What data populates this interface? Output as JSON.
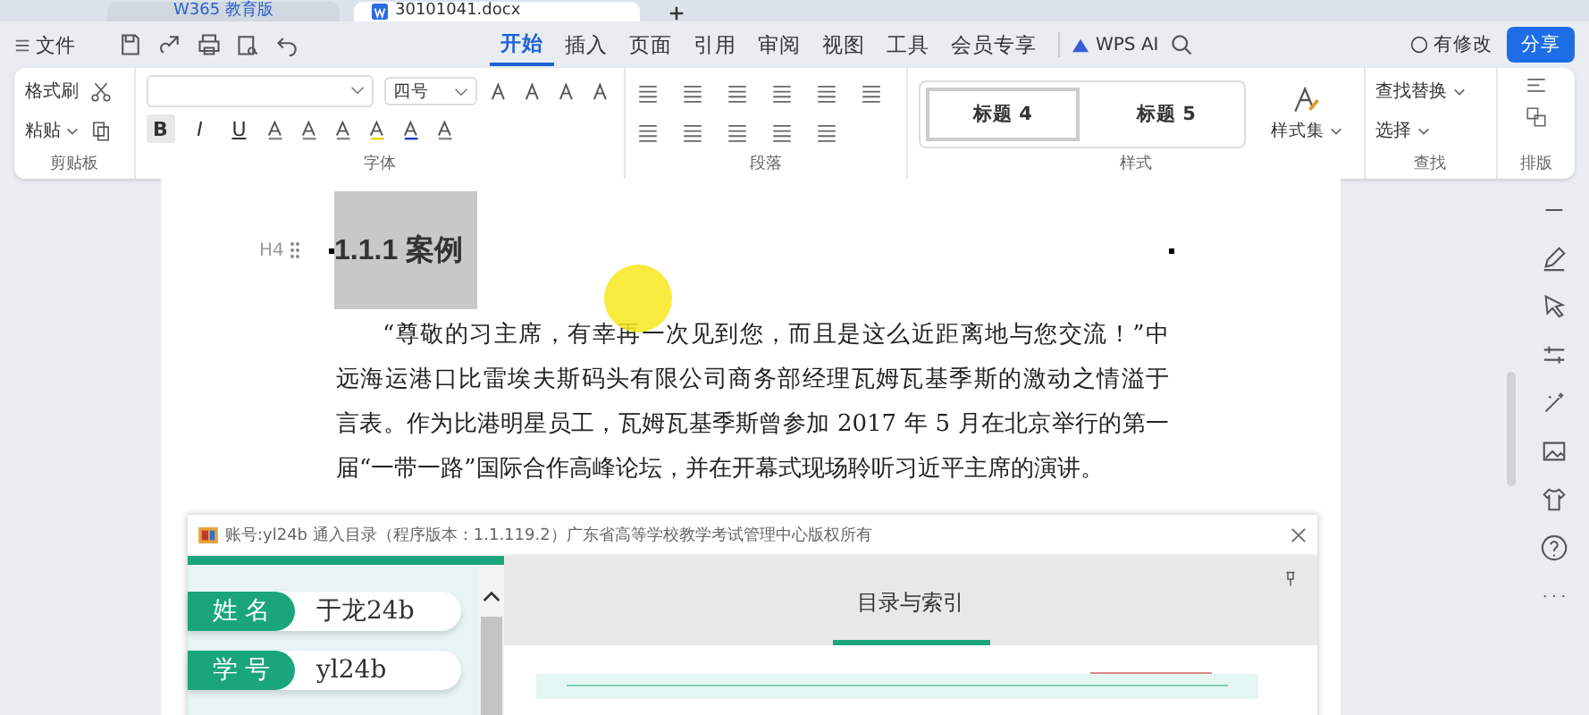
{
  "title_tabs": [
    {
      "label": "W365 教育版",
      "kind": "app",
      "selected": false
    },
    {
      "label": "30101041.docx",
      "kind": "doc",
      "selected": true
    }
  ],
  "menu": {
    "file": "文件",
    "tabs": [
      {
        "label": "开始",
        "selected": true
      },
      {
        "label": "插入",
        "selected": false
      },
      {
        "label": "页面",
        "selected": false
      },
      {
        "label": "引用",
        "selected": false
      },
      {
        "label": "审阅",
        "selected": false
      },
      {
        "label": "视图",
        "selected": false
      },
      {
        "label": "工具",
        "selected": false
      },
      {
        "label": "会员专享",
        "selected": false
      }
    ],
    "ai": "WPS AI",
    "revise": "有修改",
    "share": "分享"
  },
  "ribbon": {
    "clipboard": {
      "format_painter": "格式刷",
      "paste": "粘贴",
      "label": "剪贴板"
    },
    "font": {
      "size": "四号",
      "bold": "B",
      "italic": "I",
      "underline": "U",
      "label": "字体"
    },
    "paragraph": {
      "label": "段落"
    },
    "styles": {
      "items": [
        {
          "label": "标题 4",
          "selected": true
        },
        {
          "label": "标题 5",
          "selected": false
        }
      ],
      "style_set": "样式集",
      "label": "样式"
    },
    "find": {
      "replace": "查找替换",
      "select": "选择",
      "label": "查找"
    },
    "layout": {
      "label": "排版"
    }
  },
  "document": {
    "heading_marker": "H4",
    "heading": "1.1.1 案例",
    "paragraph_lines": [
      "“尊敬的习主席，有幸再一次见到您，而且是这么近距离地与您交流！”中",
      "远海运港口比雷埃夫斯码头有限公司商务部经理瓦姆瓦基季斯的激动之情溢于",
      "言表。作为比港明星员工，瓦姆瓦基季斯曾参加 2017 年 5 月在北京举行的第一",
      "届“一带一路”国际合作高峰论坛，并在开幕式现场聆听习近平主席的演讲。"
    ]
  },
  "dialog": {
    "title": "账号:yl24b  通入目录（程序版本：1.1.119.2）广东省高等学校教学考试管理中心版权所有",
    "fields": [
      {
        "label": "姓 名",
        "value": "于龙24b"
      },
      {
        "label": "学 号",
        "value": "yl24b"
      }
    ],
    "tabs": [
      {
        "label": "目录与索引",
        "selected": true
      }
    ]
  }
}
